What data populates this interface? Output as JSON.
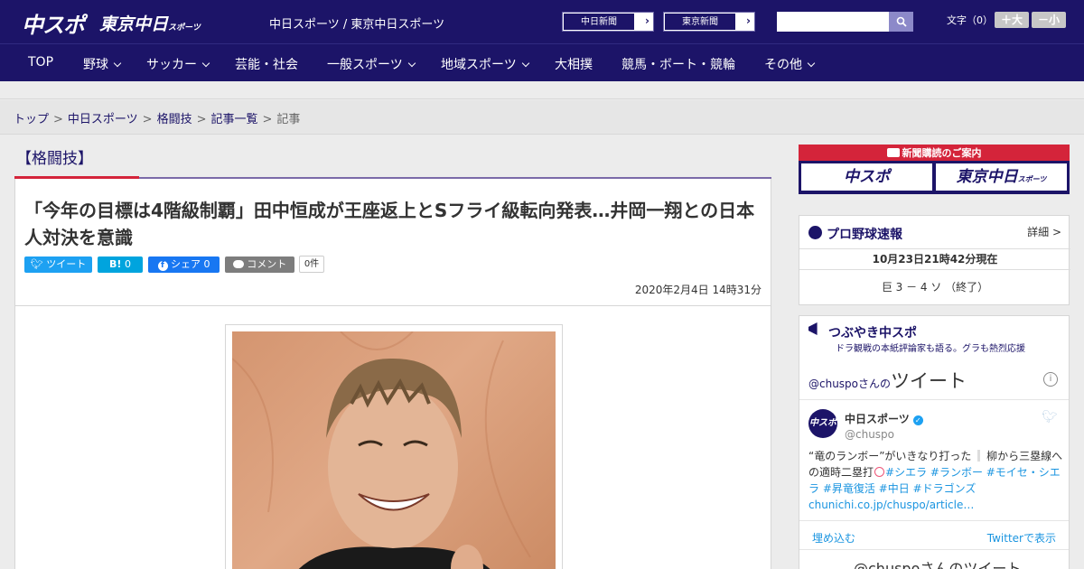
{
  "header": {
    "logo_main": "中スポ",
    "logo_sub": "東京中日",
    "logo_sub_small": "スポーツ",
    "site_names": "中日スポーツ / 東京中日スポーツ",
    "paper_buttons": [
      {
        "label": "中日新聞"
      },
      {
        "label": "東京新聞"
      }
    ],
    "search_placeholder": "",
    "font_size_label": "文字（0）",
    "font_plus": "＋大",
    "font_minus": "－小"
  },
  "nav": {
    "items": [
      {
        "label": "TOP",
        "has_menu": false
      },
      {
        "label": "野球",
        "has_menu": true
      },
      {
        "label": "サッカー",
        "has_menu": true
      },
      {
        "label": "芸能・社会",
        "has_menu": false
      },
      {
        "label": "一般スポーツ",
        "has_menu": true
      },
      {
        "label": "地域スポーツ",
        "has_menu": true
      },
      {
        "label": "大相撲",
        "has_menu": false
      },
      {
        "label": "競馬・ボート・競輪",
        "has_menu": false
      },
      {
        "label": "その他",
        "has_menu": true
      }
    ]
  },
  "breadcrumb": {
    "items": [
      "トップ",
      "中日スポーツ",
      "格闘技",
      "記事一覧"
    ],
    "current": "記事",
    "separator": ">"
  },
  "article": {
    "category": "【格闘技】",
    "headline": "「今年の目標は4階級制覇」田中恒成が王座返上とSフライ級転向発表…井岡一翔との日本人対決を意識",
    "share": {
      "tweet": "ツイート",
      "hatena_label": "B!",
      "hatena_count": "0",
      "facebook": "シェア",
      "facebook_count": "0",
      "comment": "コメント",
      "comment_count": "0件"
    },
    "date": "2020年2月4日 14時31分",
    "colors": {
      "accent_red": "#d4243a",
      "brand_navy": "#1c1468",
      "twitter_blue": "#1da1f2",
      "facebook_blue": "#1877f2",
      "hatena_blue": "#00a4de"
    }
  },
  "sidebar": {
    "subscription": {
      "title": "新聞購読のご案内",
      "buttons": [
        "中スポ",
        "東京中日"
      ],
      "button_small": "スポーツ"
    },
    "baseball": {
      "title": "プロ野球速報",
      "detail": "詳細 >",
      "time": "10月23日21時42分現在",
      "result": "巨 3 － 4 ソ （終了）"
    },
    "tweets": {
      "title": "つぶやき中スポ",
      "subtitle": "ドラ観戦の本紙評論家も語る。グラも熱烈応援",
      "embed_handle": "@chuspo",
      "embed_san": "さんの",
      "embed_word": "ツイート",
      "tweet": {
        "name": "中日スポーツ",
        "handle": "@chuspo",
        "avatar_text": "中スポ",
        "text_plain": "“竜のランボー”がいきなり打った",
        "text_mid": "柳から三塁線への適時二塁打",
        "hashtags": "#シエラ #ランボー #モイセ・シエラ #昇竜復活 #中日 #ドラゴンズ",
        "link": "chunichi.co.jp/chuspo/article…"
      },
      "embed_label": "埋め込む",
      "view_on_twitter": "Twitterで表示",
      "footer_title": "@chuspoさんのツイート"
    }
  }
}
